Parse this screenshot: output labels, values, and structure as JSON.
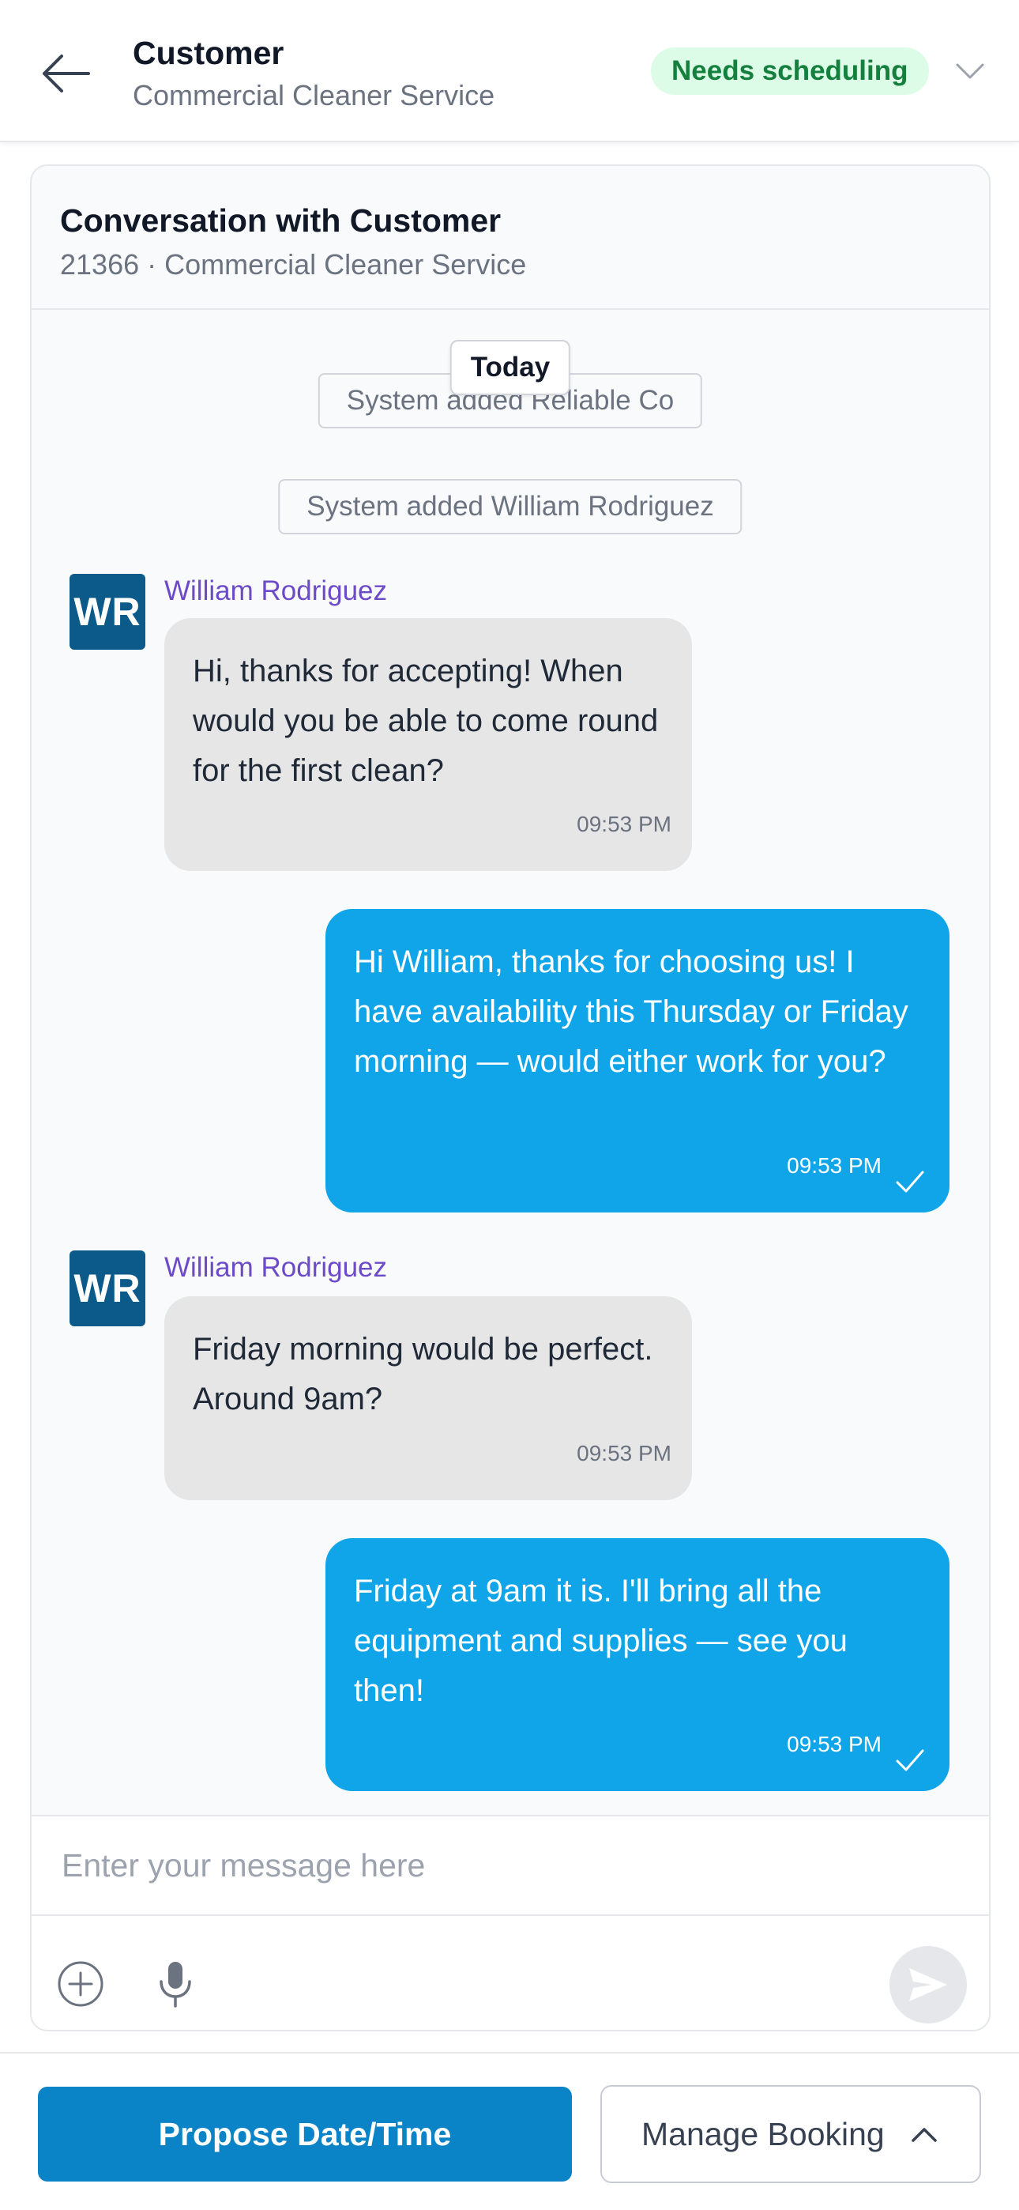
{
  "header": {
    "title": "Customer",
    "subtitle": "Commercial Cleaner Service",
    "status": "Needs scheduling",
    "back_icon": "arrow-left-icon",
    "expand_icon": "chevron-down-icon"
  },
  "conversation": {
    "title": "Conversation with Customer",
    "subtitle": "21366 · Commercial Cleaner Service",
    "day_label": "Today",
    "system_events": [
      "System added Reliable Co",
      "System added William Rodriguez"
    ],
    "messages": [
      {
        "direction": "incoming",
        "sender": "William Rodriguez",
        "initials": "WR",
        "text": "Hi, thanks for accepting! When would you be able to come round for the first clean?",
        "time": "09:53 PM"
      },
      {
        "direction": "outgoing",
        "text": "Hi William, thanks for choosing us! I have availability this Thursday or Friday morning — would either work for you?",
        "time": "09:53 PM",
        "read": true
      },
      {
        "direction": "incoming",
        "sender": "William Rodriguez",
        "initials": "WR",
        "text": "Friday morning would be perfect. Around 9am?",
        "time": "09:53 PM"
      },
      {
        "direction": "outgoing",
        "text": "Friday at 9am it is. I'll bring all the equipment and supplies — see you then!",
        "time": "09:53 PM",
        "read": true
      }
    ]
  },
  "composer": {
    "placeholder": "Enter your message here",
    "value": "",
    "attach_icon": "plus-circle-icon",
    "mic_icon": "microphone-icon",
    "send_icon": "send-icon"
  },
  "actions": {
    "primary_label": "Propose Date/Time",
    "secondary_label": "Manage Booking",
    "secondary_icon": "chevron-up-icon"
  },
  "colors": {
    "outgoing_bubble": "#10a5e8",
    "incoming_bubble": "#e6e6e6",
    "sender_name": "#6d4ac7",
    "avatar": "#0c5a8a",
    "primary_button": "#0a84c6",
    "status_badge_bg": "#dcfce7",
    "status_badge_text": "#15803d"
  }
}
